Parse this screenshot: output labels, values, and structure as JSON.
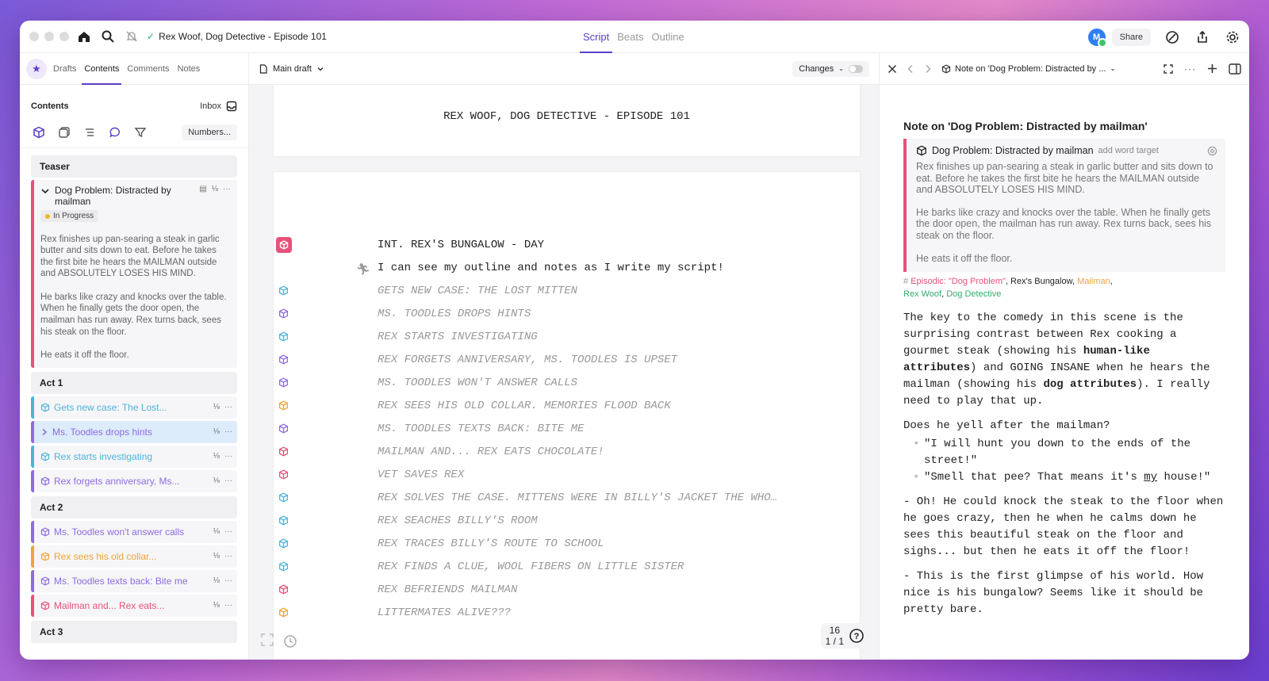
{
  "titlebar": {
    "doc_title": "Rex Woof, Dog Detective - Episode 101",
    "mode_tabs": [
      "Script",
      "Beats",
      "Outline"
    ],
    "avatar_initial": "M",
    "share_label": "Share"
  },
  "sidebar": {
    "tabs": [
      "Drafts",
      "Contents",
      "Comments",
      "Notes"
    ],
    "contents_label": "Contents",
    "inbox_label": "Inbox",
    "numbers_label": "Numbers...",
    "acts": [
      "Teaser",
      "Act 1",
      "Act 2",
      "Act 3"
    ],
    "open_scene": {
      "title": "Dog Problem: Distracted by mailman",
      "count": "⅛",
      "status": "In Progress",
      "synopsis": [
        "Rex finishes up pan-searing a steak in garlic butter and sits down to eat. Before he takes the first bite he hears the MAILMAN outside and ABSOLUTELY LOSES HIS MIND.",
        "He barks like crazy and knocks over the table. When he finally gets the door open, the mailman has run away.  Rex turns back, sees his steak on the floor.",
        "He eats it off the floor."
      ]
    },
    "act1_scenes": [
      {
        "label": "Gets new case: The Lost...",
        "count": "⅛",
        "color": "#4fb3d9"
      },
      {
        "label": "Ms. Toodles drops hints",
        "count": "⅛",
        "color": "#8d6be0"
      },
      {
        "label": "Rex starts investigating",
        "count": "⅛",
        "color": "#4fb3d9"
      },
      {
        "label": "Rex forgets anniversary, Ms...",
        "count": "⅛",
        "color": "#8d6be0"
      }
    ],
    "act2_scenes": [
      {
        "label": "Ms. Toodles won't answer calls",
        "count": "⅛",
        "color": "#8d6be0"
      },
      {
        "label": "Rex sees his old collar...",
        "count": "⅛",
        "color": "#f2a23a"
      },
      {
        "label": "Ms. Toodles texts back: Bite me",
        "count": "⅛",
        "color": "#8d6be0"
      },
      {
        "label": "Mailman and... Rex eats...",
        "count": "⅛",
        "color": "#e8517a"
      }
    ]
  },
  "editor": {
    "draft_label": "Main draft",
    "changes_label": "Changes",
    "page_title": "REX WOOF, DOG DETECTIVE - EPISODE 101",
    "scene_heading": "INT. REX'S BUNGALOW - DAY",
    "action_line": "I can see my outline and notes as I write my script!",
    "beats": [
      {
        "text": "GETS NEW CASE: THE LOST MITTEN",
        "color": "#4fb3d9"
      },
      {
        "text": "MS. TOODLES DROPS HINTS",
        "color": "#8d6be0"
      },
      {
        "text": "REX STARTS INVESTIGATING",
        "color": "#4fb3d9"
      },
      {
        "text": "REX FORGETS ANNIVERSARY, MS. TOODLES IS UPSET",
        "color": "#8d6be0"
      },
      {
        "text": "MS. TOODLES WON'T ANSWER CALLS",
        "color": "#8d6be0"
      },
      {
        "text": "REX SEES HIS OLD COLLAR. MEMORIES FLOOD BACK",
        "color": "#f2a23a"
      },
      {
        "text": "MS. TOODLES TEXTS BACK: BITE ME",
        "color": "#8d6be0"
      },
      {
        "text": "MAILMAN AND... REX EATS CHOCOLATE!",
        "color": "#e8517a"
      },
      {
        "text": "VET SAVES REX",
        "color": "#e8517a"
      },
      {
        "text": "REX SOLVES THE CASE. MITTENS WERE IN BILLY'S JACKET THE WHO…",
        "color": "#4fb3d9"
      },
      {
        "text": "REX SEACHES BILLY'S ROOM",
        "color": "#4fb3d9"
      },
      {
        "text": "REX TRACES BILLY'S ROUTE TO SCHOOL",
        "color": "#4fb3d9"
      },
      {
        "text": "REX FINDS A CLUE, WOOL FIBERS ON LITTLE SISTER",
        "color": "#4fb3d9"
      },
      {
        "text": "REX BEFRIENDS MAILMAN",
        "color": "#e8517a"
      },
      {
        "text": "LITTERMATES ALIVE???",
        "color": "#f2a23a"
      }
    ],
    "page_number": "16",
    "page_fraction": "1 / 1"
  },
  "notes": {
    "header_title": "Note on 'Dog Problem: Distracted by ...",
    "title": "Note on 'Dog Problem: Distracted by mailman'",
    "quote_title": "Dog Problem: Distracted by mailman",
    "word_target": "add word target",
    "quote_paragraphs": [
      "Rex finishes up pan-searing a steak in garlic butter and sits down to eat. Before he takes the first bite he hears the MAILMAN outside and ABSOLUTELY LOSES HIS MIND.",
      "He barks like crazy and knocks over the table. When he finally gets the door open, the mailman has run away.  Rex turns back, sees his steak on the floor.",
      "He eats it off the floor."
    ],
    "tags": [
      {
        "text": "Episodic: \"Dog Problem\"",
        "color": "#e8517a"
      },
      {
        "text": "Rex's Bungalow",
        "color": "#222222"
      },
      {
        "text": "Mailman",
        "color": "#f2a23a"
      },
      {
        "text": "Rex Woof",
        "color": "#2fae6c"
      },
      {
        "text": "Dog Detective",
        "color": "#2fae6c"
      }
    ],
    "p1_a": "The key to the comedy in this scene is the surprising contrast between Rex cooking a gourmet steak (showing his ",
    "p1_b": "human-like attributes",
    "p1_c": ") and GOING INSANE when he hears the mailman (showing his ",
    "p1_d": "dog attributes",
    "p1_e": "). I really need to play that up.",
    "p2": "Does he yell after the mailman?",
    "bullet1": "\"I will hunt you down to the ends of the street!\"",
    "bullet2_a": "\"Smell that pee? That means it's ",
    "bullet2_b": "my",
    "bullet2_c": " house!\"",
    "p3": "- Oh! He could knock the steak to the floor when he goes crazy, then he when he calms down he sees this beautiful steak on the floor and sighs... but then he eats it off the floor!",
    "p4": "- This is the first glimpse of his world. How nice is his bungalow? Seems like it should be pretty bare."
  }
}
